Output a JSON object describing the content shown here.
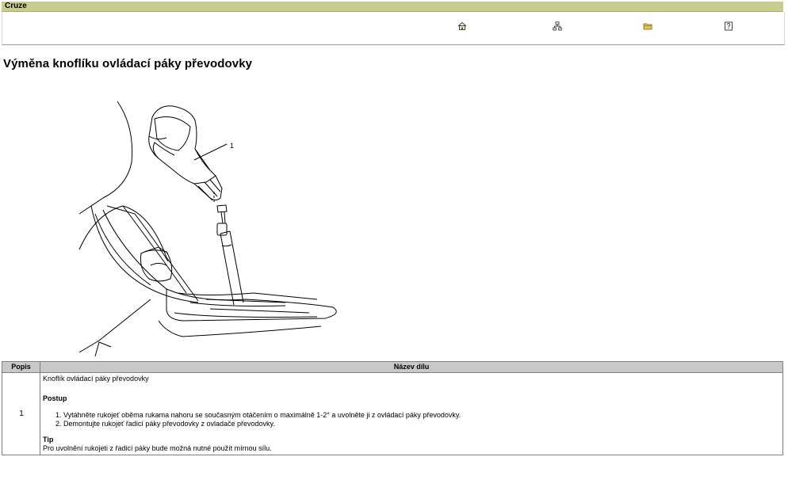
{
  "header": {
    "app_name": "Cruze",
    "nav_icons": [
      "home-icon",
      "sitemap-icon",
      "folder-icon",
      "help-icon"
    ]
  },
  "page": {
    "title": "Výměna knoflíku ovládací páky převodovky"
  },
  "figure": {
    "callout": "1"
  },
  "table": {
    "col_popis": "Popis",
    "col_nazev": "Název dílu",
    "row": {
      "number": "1",
      "part_name": "Knoflík ovládací páky převodovky",
      "procedure_heading": "Postup",
      "steps": [
        "Vytáhněte rukojeť oběma rukama nahoru se současným otáčením o maximálně 1-2° a uvolněte ji z ovládací páky převodovky.",
        "Demontujte rukojeť řadicí páky převodovky z ovladače převodovky."
      ],
      "tip_heading": "Tip",
      "tip_text": "Pro uvolnění rukojeti z řadicí páky bude možná nutné použít mírnou sílu."
    }
  }
}
